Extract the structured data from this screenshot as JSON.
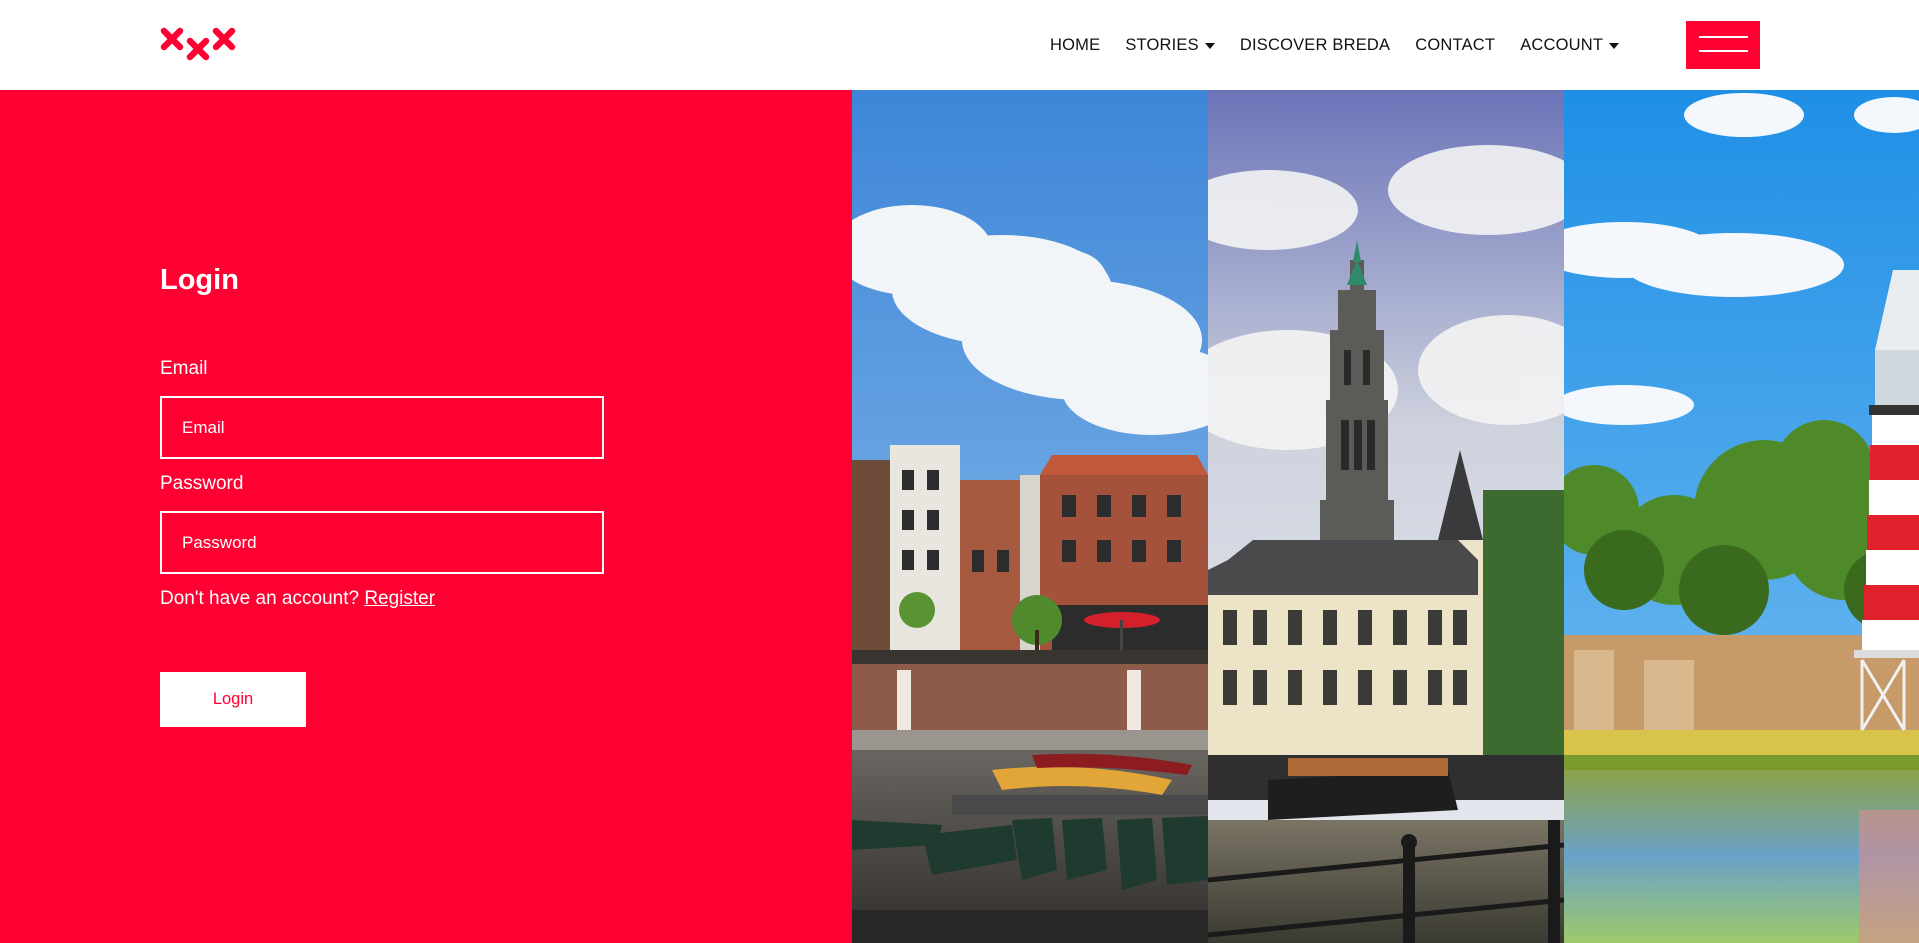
{
  "colors": {
    "brand_red": "#ff0033",
    "header_background": "#ffffff",
    "nav_text": "#111111"
  },
  "header": {
    "logo_icon": "breda-xxx-logo",
    "nav": {
      "home": "HOME",
      "stories": "STORIES",
      "discover": "DISCOVER BREDA",
      "contact": "CONTACT",
      "account": "ACCOUNT"
    },
    "menu_icon": "hamburger-menu-icon"
  },
  "login": {
    "title": "Login",
    "email_label": "Email",
    "email_placeholder": "Email",
    "email_value": "",
    "password_label": "Password",
    "password_placeholder": "Password",
    "password_value": "",
    "no_account_text": "Don't have an account?",
    "register_link": "Register",
    "submit_label": "Login"
  },
  "photos": {
    "strip_1": "breda-harbour-canal-photo",
    "strip_2": "breda-grote-kerk-tower-photo",
    "strip_3": "breda-lighthouse-park-photo"
  }
}
